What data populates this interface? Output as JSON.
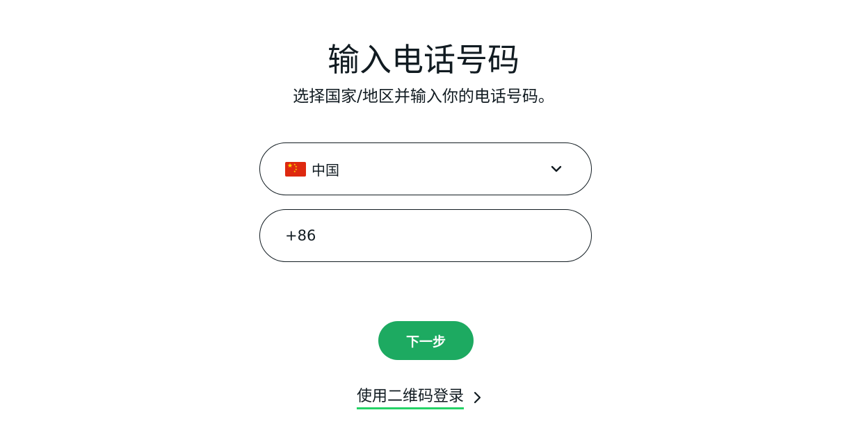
{
  "header": {
    "title": "输入电话号码",
    "subtitle": "选择国家/地区并输入你的电话号码。"
  },
  "country_select": {
    "selected": "中国",
    "flag_icon": "china-flag-icon",
    "dropdown_icon": "chevron-down-icon"
  },
  "phone": {
    "value": "+86"
  },
  "actions": {
    "next_label": "下一步",
    "qr_login_label": "使用二维码登录",
    "qr_login_icon": "chevron-right-icon"
  },
  "colors": {
    "primary": "#1daa61",
    "link_underline": "#25d366",
    "text": "#111b21"
  }
}
